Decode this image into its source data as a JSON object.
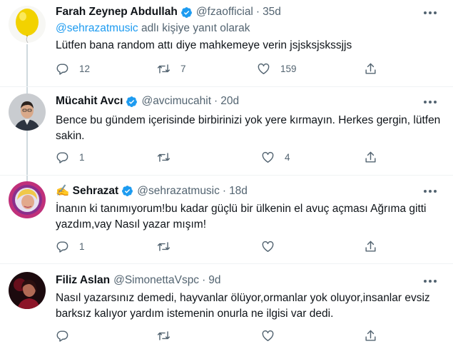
{
  "tweets": [
    {
      "name": "Farah Zeynep Abdullah",
      "verified": true,
      "handle": "@fzaofficial",
      "time": "35d",
      "reply_mention": "@sehrazatmusic",
      "reply_suffix": " adlı kişiye yanıt olarak",
      "text": "Lütfen bana random attı diye mahkemeye verin jsjsksjskssjjs",
      "replies": "12",
      "retweets": "7",
      "likes": "159",
      "avatar_icon": "yellow-balloon-avatar"
    },
    {
      "name": "Mücahit Avcı",
      "verified": true,
      "handle": "@avcimucahit",
      "time": "20d",
      "text": "Bence bu gündem içerisinde birbirinizi yok yere kırmayın. Herkes gergin, lütfen sakin.",
      "replies": "1",
      "retweets": "",
      "likes": "4",
      "avatar_icon": "man-portrait-avatar"
    },
    {
      "name": "✍️ Sehrazat",
      "verified": true,
      "handle": "@sehrazatmusic",
      "time": "18d",
      "text": "İnanın ki tanımıyorum!bu kadar güçlü bir ülkenin el avuç açması Ağrıma gitti yazdım,vay Nasıl yazar mışım!",
      "replies": "1",
      "retweets": "",
      "likes": "",
      "avatar_icon": "woman-portrait-avatar"
    },
    {
      "name": "Filiz Aslan",
      "verified": false,
      "handle": "@SimonettaVspc",
      "time": "9d",
      "text": "Nasıl yazarsınız demedi, hayvanlar ölüyor,ormanlar yok oluyor,insanlar evsiz barksız kalıyor yardım istemenin onurla ne ilgisi var dedi.",
      "replies": "",
      "retweets": "",
      "likes": "",
      "avatar_icon": "dark-portrait-avatar"
    }
  ],
  "separator": "·",
  "colors": {
    "accent": "#1d9bf0",
    "secondary_text": "#536471",
    "thread_line": "#cfd9de"
  }
}
